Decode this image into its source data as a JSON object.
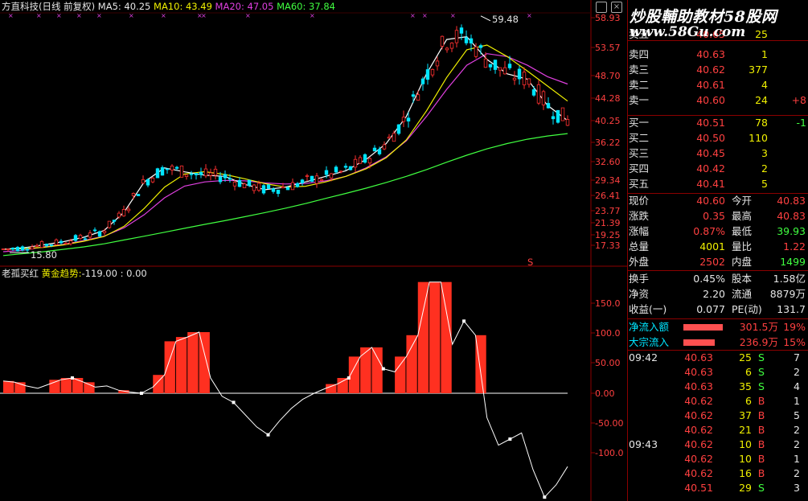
{
  "header": {
    "title": "方直科技(日线 前复权)",
    "ma5": "MA5: 40.25",
    "ma10": "MA10: 43.49",
    "ma20": "MA20: 47.05",
    "ma60": "MA60: 37.84",
    "high_label": "59.48",
    "low_label": "15.80",
    "signal_mark": "S"
  },
  "indicator": {
    "name": "老孤买红",
    "subtitle": "黄金趋势:",
    "values": "-119.00 : 0.00"
  },
  "price_axis": [
    "58.93",
    "53.57",
    "48.70",
    "44.28",
    "40.25",
    "36.22",
    "32.60",
    "29.34",
    "26.41",
    "23.77",
    "21.39",
    "19.25",
    "17.33"
  ],
  "ind_axis": [
    "150.0",
    "100.0",
    "50.00",
    "0.00",
    "-50.00",
    "-100.0"
  ],
  "watermark": {
    "line1": "炒股輔助教材58股网",
    "line2": "www.58Gu.com"
  },
  "order_book": {
    "asks": [
      {
        "label": "卖五",
        "price": "40.65",
        "vol": "25",
        "chg": ""
      },
      {
        "label": "卖四",
        "price": "40.63",
        "vol": "1",
        "chg": ""
      },
      {
        "label": "卖三",
        "price": "40.62",
        "vol": "377",
        "chg": ""
      },
      {
        "label": "卖二",
        "price": "40.61",
        "vol": "4",
        "chg": ""
      },
      {
        "label": "卖一",
        "price": "40.60",
        "vol": "24",
        "chg": "+8"
      }
    ],
    "bids": [
      {
        "label": "买一",
        "price": "40.51",
        "vol": "78",
        "chg": "-1"
      },
      {
        "label": "买二",
        "price": "40.50",
        "vol": "110",
        "chg": ""
      },
      {
        "label": "买三",
        "price": "40.45",
        "vol": "3",
        "chg": ""
      },
      {
        "label": "买四",
        "price": "40.42",
        "vol": "2",
        "chg": ""
      },
      {
        "label": "买五",
        "price": "40.41",
        "vol": "5",
        "chg": ""
      }
    ]
  },
  "quote": [
    {
      "k1": "现价",
      "v1": "40.60",
      "k2": "今开",
      "v2": "40.83"
    },
    {
      "k1": "涨跌",
      "v1": "0.35",
      "k2": "最高",
      "v2": "40.83"
    },
    {
      "k1": "涨幅",
      "v1": "0.87%",
      "k2": "最低",
      "v2": "39.93"
    },
    {
      "k1": "总量",
      "v1": "4001",
      "k2": "量比",
      "v2": "1.22"
    },
    {
      "k1": "外盘",
      "v1": "2502",
      "k2": "内盘",
      "v2": "1499"
    }
  ],
  "stats": [
    {
      "k1": "换手",
      "v1": "0.45%",
      "k2": "股本",
      "v2": "1.58亿"
    },
    {
      "k1": "净资",
      "v1": "2.20",
      "k2": "流通",
      "v2": "8879万"
    },
    {
      "k1": "收益(一)",
      "v1": "0.077",
      "k2": "PE(动)",
      "v2": "131.7"
    }
  ],
  "flows": [
    {
      "label": "净流入额",
      "value": "301.5万",
      "pct": "19%",
      "fill": 0.19
    },
    {
      "label": "大宗流入",
      "value": "236.9万",
      "pct": "15%",
      "fill": 0.15
    }
  ],
  "ticks": [
    {
      "time": "09:42",
      "price": "40.63",
      "vol": "25",
      "bs": "S",
      "n": "7"
    },
    {
      "time": "",
      "price": "40.63",
      "vol": "6",
      "bs": "S",
      "n": "2"
    },
    {
      "time": "",
      "price": "40.63",
      "vol": "35",
      "bs": "S",
      "n": "4"
    },
    {
      "time": "",
      "price": "40.62",
      "vol": "6",
      "bs": "B",
      "n": "1"
    },
    {
      "time": "",
      "price": "40.62",
      "vol": "37",
      "bs": "B",
      "n": "5"
    },
    {
      "time": "",
      "price": "40.62",
      "vol": "21",
      "bs": "B",
      "n": "2"
    },
    {
      "time": "09:43",
      "price": "40.62",
      "vol": "10",
      "bs": "B",
      "n": "2"
    },
    {
      "time": "",
      "price": "40.62",
      "vol": "10",
      "bs": "B",
      "n": "1"
    },
    {
      "time": "",
      "price": "40.62",
      "vol": "16",
      "bs": "B",
      "n": "2"
    },
    {
      "time": "",
      "price": "40.51",
      "vol": "29",
      "bs": "S",
      "n": "3"
    }
  ],
  "colors": {
    "up": "#ff3030",
    "down": "#00e5ff",
    "ma5": "#ffffff",
    "ma10": "#f0f000",
    "ma20": "#e040e0",
    "ma60": "#40ff40",
    "frame": "#8b0000"
  },
  "chart_data": {
    "type": "line",
    "price_series": {
      "ma60": [
        15.2,
        15.6,
        16.0,
        16.5,
        17.0,
        17.6,
        18.3,
        19.0,
        19.7,
        20.4,
        21.1,
        21.8,
        22.6,
        23.4,
        24.2,
        25.0,
        25.9,
        26.8,
        27.8,
        28.9,
        30.0,
        31.2,
        32.5,
        33.8,
        35.0,
        36.0,
        36.8,
        37.4,
        37.84
      ],
      "ma20": [
        16.0,
        16.3,
        17.0,
        17.5,
        18.2,
        19.0,
        20.5,
        23.0,
        26.0,
        28.2,
        29.0,
        29.3,
        29.2,
        28.8,
        28.6,
        28.7,
        29.2,
        30.0,
        31.5,
        33.5,
        36.5,
        41.0,
        46.0,
        50.5,
        52.5,
        52.0,
        50.5,
        48.5,
        47.05
      ],
      "ma5": [
        16.5,
        16.8,
        17.4,
        18.0,
        18.8,
        20.0,
        23.5,
        29.0,
        31.5,
        30.8,
        30.2,
        30.0,
        28.5,
        27.5,
        28.0,
        29.0,
        30.0,
        31.0,
        33.0,
        36.0,
        41.0,
        49.0,
        55.0,
        55.5,
        51.5,
        49.0,
        48.0,
        43.0,
        40.25
      ]
    },
    "indicator_series": [
      20,
      18,
      12,
      8,
      15,
      22,
      25,
      18,
      10,
      12,
      5,
      2,
      0,
      10,
      30,
      85,
      92,
      100,
      25,
      -5,
      -15,
      -35,
      -55,
      -68,
      -45,
      -25,
      -10,
      0,
      8,
      15,
      25,
      60,
      75,
      40,
      35,
      60,
      95,
      182,
      182,
      80,
      118,
      95,
      -40,
      -85,
      -75,
      -65,
      -125,
      -170,
      -150,
      -120
    ]
  }
}
